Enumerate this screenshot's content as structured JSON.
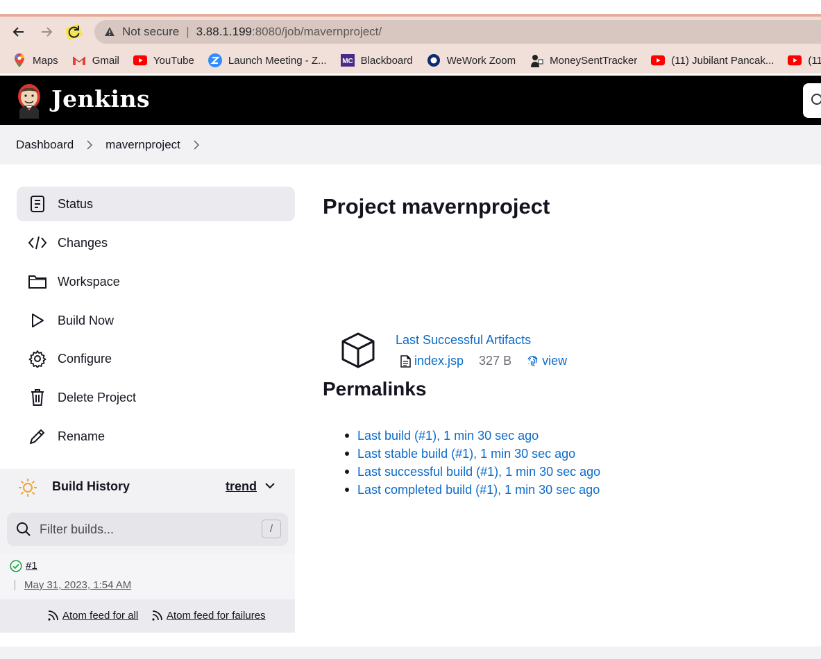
{
  "browser": {
    "not_secure": "Not secure",
    "url_host": "3.88.1.199",
    "url_path": ":8080/job/mavernproject/",
    "bookmarks": [
      {
        "label": "Maps",
        "icon": "maps-icon"
      },
      {
        "label": "Gmail",
        "icon": "gmail-icon"
      },
      {
        "label": "YouTube",
        "icon": "youtube-icon"
      },
      {
        "label": "Launch Meeting - Z...",
        "icon": "zoom-icon"
      },
      {
        "label": "Blackboard",
        "icon": "blackboard-icon"
      },
      {
        "label": "WeWork Zoom",
        "icon": "wework-icon"
      },
      {
        "label": "MoneySentTracker",
        "icon": "tracker-icon"
      },
      {
        "label": "(11) Jubilant Pancak...",
        "icon": "youtube-icon"
      },
      {
        "label": "(11)",
        "icon": "youtube-icon"
      }
    ]
  },
  "header": {
    "title": "Jenkins"
  },
  "breadcrumb": {
    "items": [
      "Dashboard",
      "mavernproject"
    ]
  },
  "sidebar": {
    "tasks": [
      {
        "label": "Status",
        "icon": "status-icon"
      },
      {
        "label": "Changes",
        "icon": "code-icon"
      },
      {
        "label": "Workspace",
        "icon": "folder-icon"
      },
      {
        "label": "Build Now",
        "icon": "play-icon"
      },
      {
        "label": "Configure",
        "icon": "gear-icon"
      },
      {
        "label": "Delete Project",
        "icon": "trash-icon"
      },
      {
        "label": "Rename",
        "icon": "pencil-icon"
      }
    ]
  },
  "build_history": {
    "title": "Build History",
    "trend": "trend",
    "filter_placeholder": "Filter builds...",
    "shortcut": "/",
    "builds": [
      {
        "number": "#1",
        "date": "May 31, 2023, 1:54 AM",
        "status": "success"
      }
    ],
    "feed_all": "Atom feed for all",
    "feed_failures": "Atom feed for failures"
  },
  "main": {
    "title": "Project mavernproject",
    "artifacts": {
      "title": "Last Successful Artifacts",
      "file": "index.jsp",
      "size": "327 B",
      "view": "view"
    },
    "permalinks_title": "Permalinks",
    "permalinks": [
      "Last build (#1), 1 min 30 sec ago",
      "Last stable build (#1), 1 min 30 sec ago",
      "Last successful build (#1), 1 min 30 sec ago",
      "Last completed build (#1), 1 min 30 sec ago"
    ]
  },
  "colors": {
    "link": "#0b6bcb",
    "header_bg": "#000000",
    "success": "#1ea64b"
  }
}
